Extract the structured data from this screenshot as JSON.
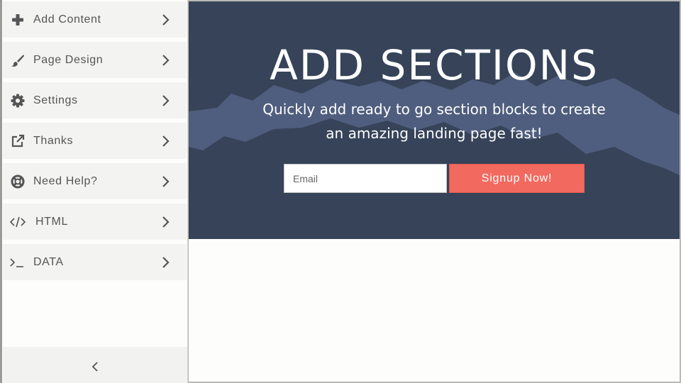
{
  "sidebar": {
    "items": [
      {
        "label": "Add Content",
        "icon": "plus-icon"
      },
      {
        "label": "Page Design",
        "icon": "paintbrush-icon"
      },
      {
        "label": "Settings",
        "icon": "gear-icon"
      },
      {
        "label": "Thanks",
        "icon": "external-link-icon"
      },
      {
        "label": "Need Help?",
        "icon": "life-ring-icon"
      },
      {
        "label": "HTML",
        "icon": "code-icon"
      },
      {
        "label": "DATA",
        "icon": "terminal-icon"
      }
    ],
    "collapse_icon": "chevron-left-icon"
  },
  "hero": {
    "title": "ADD SECTIONS",
    "subtitle": "Quickly add ready to go section blocks to create an amazing landing page fast!",
    "email_placeholder": "Email",
    "signup_label": "Signup Now!"
  },
  "colors": {
    "hero_background": "#364359",
    "mountains": "#4f5e7e",
    "signup_button": "#f2695f",
    "sidebar_item": "#f3f3f2",
    "sidebar_text": "#555555"
  }
}
